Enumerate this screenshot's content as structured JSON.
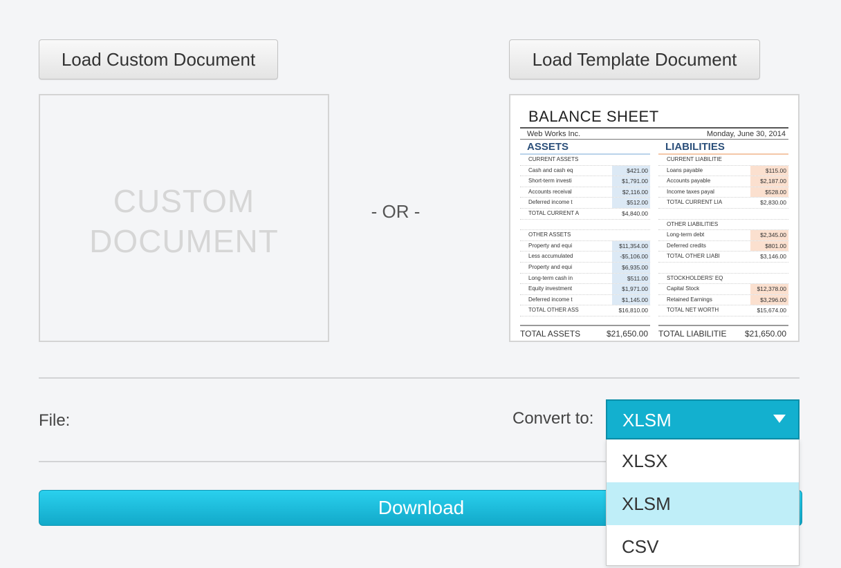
{
  "buttons": {
    "load_custom": "Load Custom Document",
    "load_template": "Load Template Document",
    "download": "Download"
  },
  "custom_placeholder": {
    "line1": "CUSTOM",
    "line2": "DOCUMENT"
  },
  "or_text": "- OR -",
  "template_preview": {
    "title": "BALANCE SHEET",
    "company": "Web Works Inc.",
    "date": "Monday, June 30, 2014",
    "assets": {
      "heading": "ASSETS",
      "rows": [
        {
          "label": "CURRENT ASSETS",
          "value": ""
        },
        {
          "label": "Cash and cash eq",
          "value": "$421.00"
        },
        {
          "label": "Short-term investi",
          "value": "$1,791.00"
        },
        {
          "label": "Accounts receival",
          "value": "$2,116.00"
        },
        {
          "label": "Deferred income t",
          "value": "$512.00"
        },
        {
          "label": "TOTAL CURRENT A",
          "value": "$4,840.00"
        },
        {
          "label": "",
          "value": ""
        },
        {
          "label": "OTHER ASSETS",
          "value": ""
        },
        {
          "label": "Property and equi",
          "value": "$11,354.00"
        },
        {
          "label": "Less accumulated",
          "value": "-$5,106.00"
        },
        {
          "label": "Property and equi",
          "value": "$6,935.00"
        },
        {
          "label": "Long-term cash in",
          "value": "$511.00"
        },
        {
          "label": "Equity investment",
          "value": "$1,971.00"
        },
        {
          "label": "Deferred income t",
          "value": "$1,145.00"
        },
        {
          "label": "TOTAL OTHER ASS",
          "value": "$16,810.00"
        }
      ],
      "total_label": "TOTAL ASSETS",
      "total_value": "$21,650.00"
    },
    "liabilities": {
      "heading": "LIABILITIES",
      "rows": [
        {
          "label": "CURRENT LIABILITIE",
          "value": ""
        },
        {
          "label": "Loans payable",
          "value": "$115.00"
        },
        {
          "label": "Accounts payable",
          "value": "$2,187.00"
        },
        {
          "label": "Income taxes payal",
          "value": "$528.00"
        },
        {
          "label": "TOTAL CURRENT LIA",
          "value": "$2,830.00"
        },
        {
          "label": "",
          "value": ""
        },
        {
          "label": "OTHER LIABILITIES",
          "value": ""
        },
        {
          "label": "Long-term debt",
          "value": "$2,345.00"
        },
        {
          "label": "Deferred credits",
          "value": "$801.00"
        },
        {
          "label": "TOTAL OTHER LIABI",
          "value": "$3,146.00"
        },
        {
          "label": "",
          "value": ""
        },
        {
          "label": "STOCKHOLDERS' EQ",
          "value": ""
        },
        {
          "label": "Capital Stock",
          "value": "$12,378.00"
        },
        {
          "label": "Retained Earnings",
          "value": "$3,296.00"
        },
        {
          "label": "TOTAL NET WORTH",
          "value": "$15,674.00"
        }
      ],
      "total_label": "TOTAL LIABILITIE",
      "total_value": "$21,650.00"
    }
  },
  "file_label": "File:",
  "convert": {
    "label": "Convert to:",
    "selected": "XLSM",
    "options": [
      "XLSX",
      "XLSM",
      "CSV"
    ]
  },
  "colors": {
    "accent": "#13b0cf",
    "selected_option_bg": "#bfeef8",
    "background": "#f4f5f7"
  }
}
